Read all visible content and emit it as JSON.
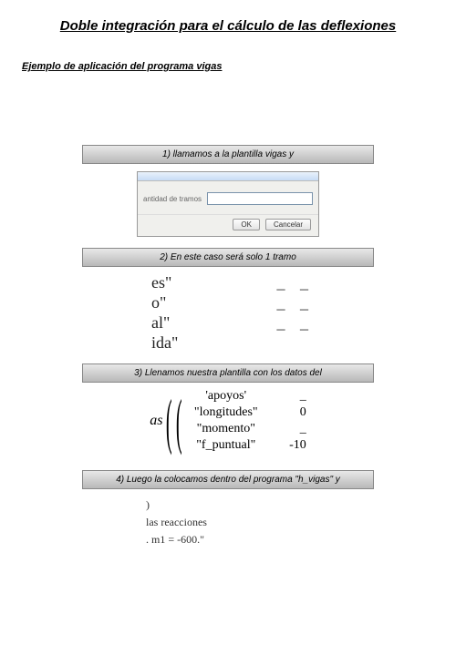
{
  "title": "Doble integración para el cálculo de las deflexiones",
  "subtitle": "Ejemplo de aplicación del programa vigas ",
  "steps": {
    "s1": "1) llamamos   a la plantilla vigas y",
    "s2": "2) En este caso será solo 1 tramo",
    "s3": "3) Llenamos nuestra plantilla con los datos del",
    "s4": "4) Luego la colocamos dentro del programa \"h_vigas\"  y"
  },
  "dialog": {
    "label": "antidad de tramos",
    "ok": "OK",
    "cancel": "Cancelar"
  },
  "frag1": {
    "rows": [
      {
        "k": "es\"",
        "v": "_  _"
      },
      {
        "k": "o\"",
        "v": "_  _"
      },
      {
        "k": "al\"",
        "v": "_  _"
      },
      {
        "k": "ida\"",
        "v": ""
      }
    ]
  },
  "frag2": {
    "as": "as",
    "rows": [
      {
        "k": "'apoyos'",
        "v": "_"
      },
      {
        "k": "\"longitudes\"",
        "v": "0"
      },
      {
        "k": "\"momento\"",
        "v": "_"
      },
      {
        "k": "\"f_puntual\"",
        "v": "-10"
      }
    ]
  },
  "frag3": {
    "l1": ")",
    "l2": "las reacciones",
    "l3": ".   m1 = -600.\""
  }
}
